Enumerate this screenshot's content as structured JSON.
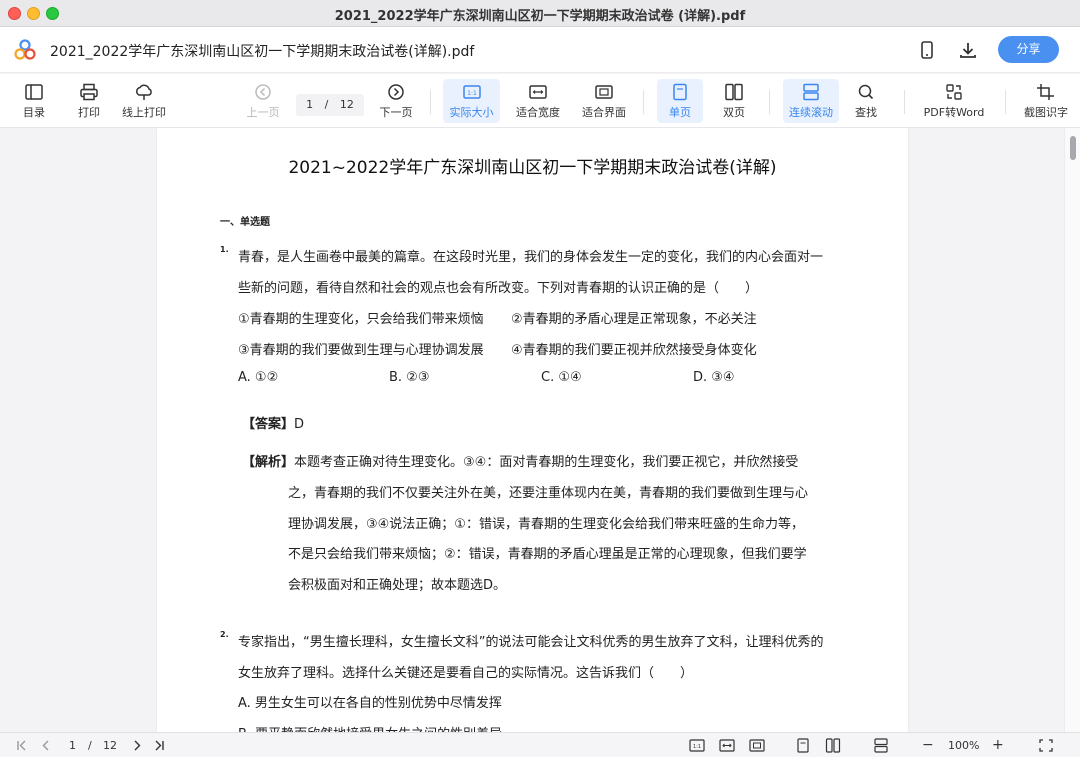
{
  "window": {
    "title": "2021_2022学年广东深圳南山区初一下学期期末政治试卷 (详解).pdf",
    "colors": {
      "close": "#fe5f57",
      "minimize": "#febc2e",
      "maximize": "#28c840"
    }
  },
  "header": {
    "doc_title": "2021_2022学年广东深圳南山区初一下学期期末政治试卷(详解).pdf",
    "share_label": "分享",
    "accent": "#4a90f0",
    "icons": [
      "app-logo-icon",
      "phone-icon",
      "download-icon"
    ]
  },
  "toolbar": {
    "toc": "目录",
    "print": "打印",
    "online_print": "线上打印",
    "prev": "上一页",
    "page_current": "1",
    "page_sep": "/",
    "page_total": "12",
    "next": "下一页",
    "actual_size": "实际大小",
    "fit_width": "适合宽度",
    "fit_page": "适合界面",
    "single": "单页",
    "double": "双页",
    "continuous": "连续滚动",
    "search": "查找",
    "pdf2word": "PDF转Word",
    "ocr": "截图识字",
    "active_color": "#3a86ee"
  },
  "page": {
    "title": "2021~2022学年广东深圳南山区初一下学期期末政治试卷(详解)",
    "section": "一、单选题",
    "q1": {
      "num": "1.",
      "line1": "青春，是人生画卷中最美的篇章。在这段时光里，我们的身体会发生一定的变化，我们的内心会面对一",
      "line2": "些新的问题，看待自然和社会的观点也会有所改变。下列对青春期的认识正确的是（　　）",
      "stmt1": "①青春期的生理变化，只会给我们带来烦恼",
      "stmt2": "②青春期的矛盾心理是正常现象，不必关注",
      "stmt3": "③青春期的我们要做到生理与心理协调发展",
      "stmt4": "④青春期的我们要正视并欣然接受身体变化",
      "optA": "A. ①②",
      "optB": "B. ②③",
      "optC": "C. ①④",
      "optD": "D. ③④",
      "answer_tag": "【答案】",
      "answer": "D",
      "analysis_tag": "【解析】",
      "analysis1": "本题考查正确对待生理变化。③④：面对青春期的生理变化，我们要正视它，并欣然接受",
      "analysis2": "之，青春期的我们不仅要关注外在美，还要注重体现内在美，青春期的我们要做到生理与心",
      "analysis3": "理协调发展，③④说法正确；①：错误，青春期的生理变化会给我们带来旺盛的生命力等，",
      "analysis4": "不是只会给我们带来烦恼；②：错误，青春期的矛盾心理虽是正常的心理现象，但我们要学",
      "analysis5": "会积极面对和正确处理；故本题选D。"
    },
    "q2": {
      "num": "2.",
      "line1": "专家指出，“男生擅长理科，女生擅长文科”的说法可能会让文科优秀的男生放弃了文科，让理科优秀的",
      "line2": "女生放弃了理科。选择什么关键还是要看自己的实际情况。这告诉我们（　　）",
      "optA": "A. 男生女生可以在各自的性别优势中尽情发挥",
      "optB": "B. 要平静而欣然地接受男女生之间的性别差异"
    }
  },
  "statusbar": {
    "page_current": "1",
    "page_sep": "/",
    "page_total": "12",
    "zoom": "100%",
    "zoom_minus": "−",
    "zoom_plus": "+"
  }
}
